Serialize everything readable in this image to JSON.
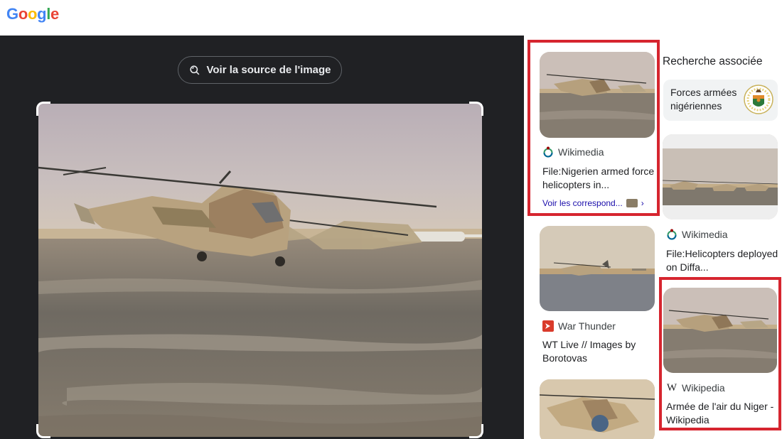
{
  "header": {
    "logo_text": "Google",
    "logo_letters": [
      "G",
      "o",
      "o",
      "g",
      "l",
      "e"
    ],
    "logo_colors": [
      "#4285f4",
      "#ea4335",
      "#fbbc05",
      "#4285f4",
      "#34a853",
      "#ea4335"
    ]
  },
  "viewer": {
    "source_button_label": "Voir la source de l'image",
    "source_icon": "lens-search-icon"
  },
  "results": {
    "related_heading": "Recherche associée",
    "related_chip": {
      "label": "Forces armées nigériennes",
      "icon": "armed-forces-emblem-icon"
    },
    "items": [
      {
        "source": "Wikimedia",
        "source_icon": "wikimedia-icon",
        "title": "File:Nigerien armed force helicopters in...",
        "link": "Voir les correspond...",
        "highlighted": true
      },
      {
        "source": "Wikimedia",
        "source_icon": "wikimedia-icon",
        "title": "File:Helicopters deployed on Diffa...",
        "highlighted": false
      },
      {
        "source": "War Thunder",
        "source_icon": "war-thunder-icon",
        "title": "WT Live // Images by Borotovas",
        "highlighted": false
      },
      {
        "source": "Wikipedia",
        "source_icon": "wikipedia-icon",
        "title": "Armée de l'air du Niger - Wikipedia",
        "highlighted": true
      }
    ]
  },
  "colors": {
    "highlight_red": "#d6252f",
    "viewer_bg": "#202124",
    "link_blue": "#1a0dab"
  }
}
